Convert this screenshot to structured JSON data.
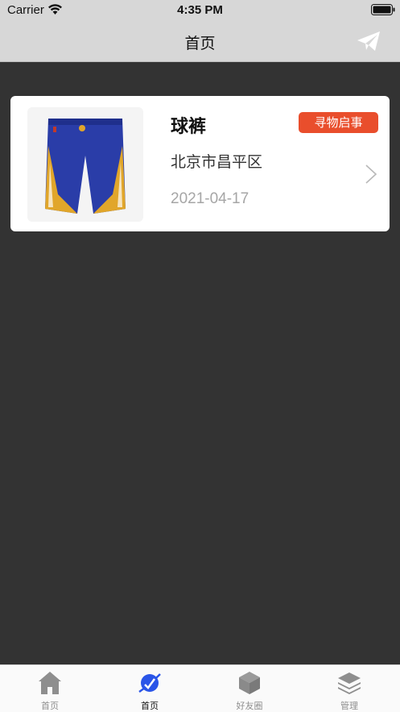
{
  "status_bar": {
    "carrier": "Carrier",
    "time": "4:35 PM"
  },
  "nav": {
    "title": "首页",
    "right_icon": "send-icon"
  },
  "items": [
    {
      "title": "球裤",
      "badge": "寻物启事",
      "location": "北京市昌平区",
      "date": "2021-04-17",
      "image": "basketball-shorts"
    }
  ],
  "tabs": [
    {
      "label": "首页",
      "icon": "home-icon",
      "active": false
    },
    {
      "label": "首页",
      "icon": "planet-icon",
      "active": true
    },
    {
      "label": "好友圈",
      "icon": "cube-icon",
      "active": false
    },
    {
      "label": "管理",
      "icon": "layers-icon",
      "active": false
    }
  ],
  "colors": {
    "background": "#333333",
    "header": "#d7d7d7",
    "badge": "#e94e2c",
    "active_tab": "#2a55e8",
    "inactive_tab": "#8e8e8e"
  }
}
